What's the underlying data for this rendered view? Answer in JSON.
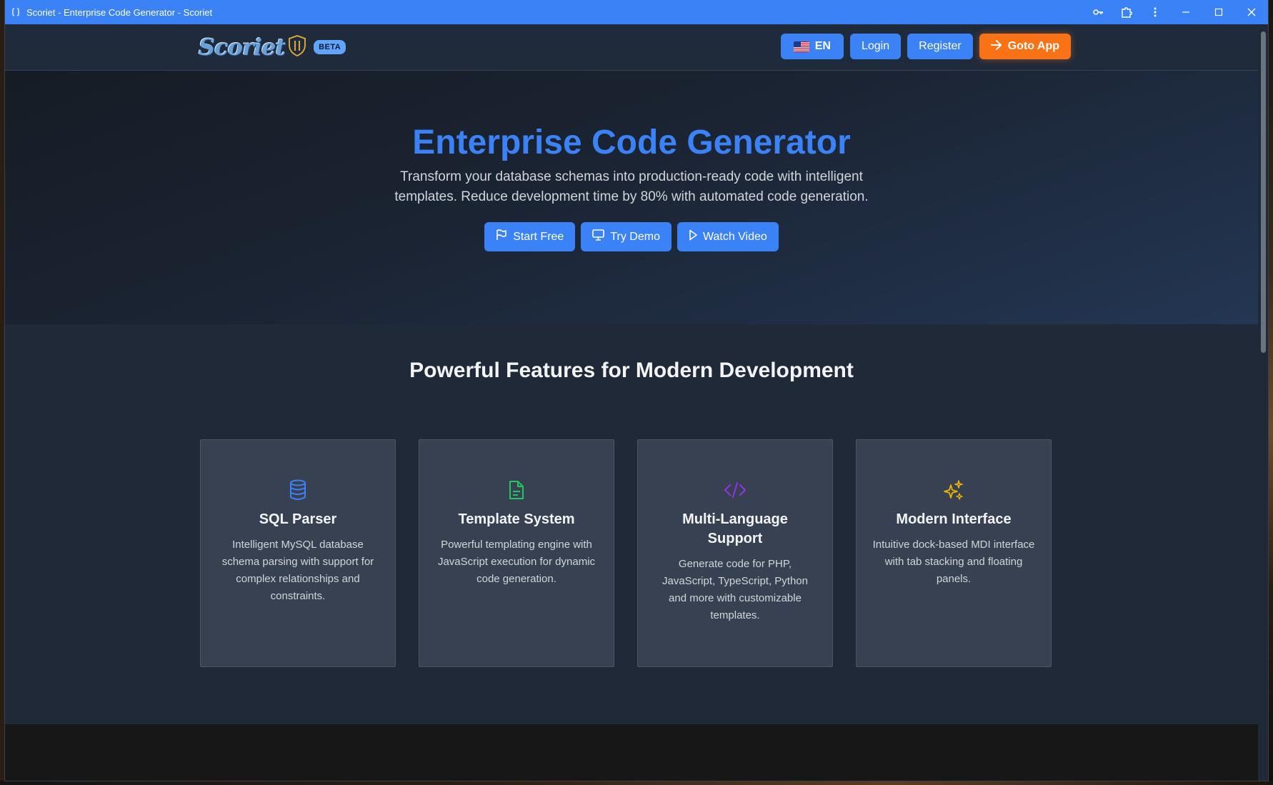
{
  "window": {
    "title": "Scoriet - Enterprise Code Generator - Scoriet"
  },
  "navbar": {
    "logo_text": "Scoriet",
    "beta_label": "BETA",
    "lang_label": "EN",
    "login_label": "Login",
    "register_label": "Register",
    "goto_label": "Goto App"
  },
  "hero": {
    "title": "Enterprise Code Generator",
    "subtitle": "Transform your database schemas into production-ready code with intelligent templates. Reduce development time by 80% with automated code generation.",
    "buttons": {
      "start_free": "Start Free",
      "try_demo": "Try Demo",
      "watch_video": "Watch Video"
    }
  },
  "features": {
    "title": "Powerful Features for Modern Development",
    "cards": [
      {
        "icon": "database-icon",
        "title": "SQL Parser",
        "description": "Intelligent MySQL database schema parsing with support for complex relationships and constraints.",
        "icon_color": "#3b82f6"
      },
      {
        "icon": "file-text-icon",
        "title": "Template System",
        "description": "Powerful templating engine with JavaScript execution for dynamic code generation.",
        "icon_color": "#22c55e"
      },
      {
        "icon": "code-icon",
        "title": "Multi-Language Support",
        "description": "Generate code for PHP, JavaScript, TypeScript, Python and more with customizable templates.",
        "icon_color": "#9333ea"
      },
      {
        "icon": "sparkles-icon",
        "title": "Modern Interface",
        "description": "Intuitive dock-based MDI interface with tab stacking and floating panels.",
        "icon_color": "#eab308"
      }
    ]
  },
  "colors": {
    "primary": "#3b82f6",
    "accent": "#f97316",
    "background": "#1f2937",
    "card": "#374151"
  }
}
